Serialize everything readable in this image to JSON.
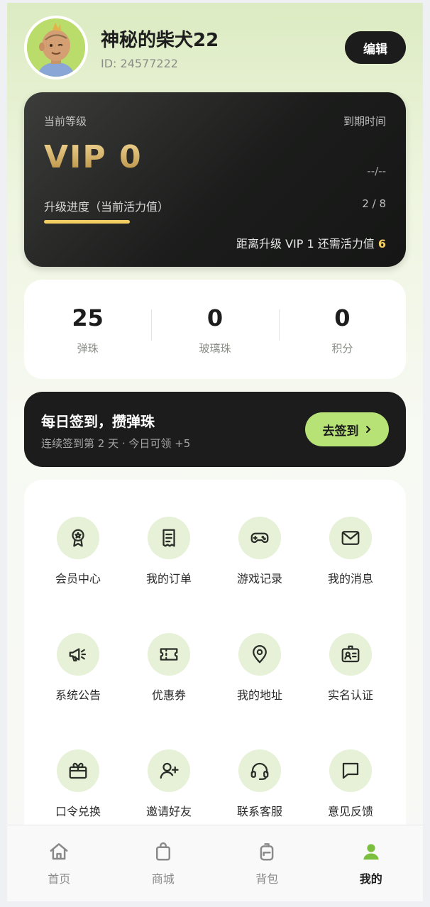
{
  "profile": {
    "username": "神秘的柴犬22",
    "id_text": "ID: 24577222",
    "edit_label": "编辑",
    "avatar_icon": "cartoon-avatar"
  },
  "vip": {
    "level_label": "当前等级",
    "level": "VIP 0",
    "expire_label": "到期时间",
    "expire_value": "--/--",
    "progress_label": "升级进度（当前活力值）",
    "progress_text": "2 / 8",
    "progress_fraction": 0.25,
    "upgrade_prefix": "距离升级 VIP 1 还需活力值 ",
    "upgrade_need": "6",
    "gold_color": "#f3cf63"
  },
  "stats": [
    {
      "value": "25",
      "label": "弹珠"
    },
    {
      "value": "0",
      "label": "玻璃珠"
    },
    {
      "value": "0",
      "label": "积分"
    }
  ],
  "checkin": {
    "title": "每日签到，攒弹珠",
    "subtitle": "连续签到第 2 天 · 今日可领 +5",
    "button_label": "去签到",
    "accent": "#b7e276"
  },
  "menu": [
    {
      "label": "会员中心",
      "icon": "medal-icon"
    },
    {
      "label": "我的订单",
      "icon": "receipt-icon"
    },
    {
      "label": "游戏记录",
      "icon": "gamepad-icon"
    },
    {
      "label": "我的消息",
      "icon": "mail-icon"
    },
    {
      "label": "系统公告",
      "icon": "megaphone-icon"
    },
    {
      "label": "优惠券",
      "icon": "ticket-icon"
    },
    {
      "label": "我的地址",
      "icon": "location-pin-icon"
    },
    {
      "label": "实名认证",
      "icon": "id-badge-icon"
    },
    {
      "label": "口令兑换",
      "icon": "gift-icon"
    },
    {
      "label": "邀请好友",
      "icon": "add-user-icon"
    },
    {
      "label": "联系客服",
      "icon": "headset-icon"
    },
    {
      "label": "意见反馈",
      "icon": "chat-icon"
    }
  ],
  "nav": [
    {
      "label": "首页",
      "icon": "home-icon",
      "active": false
    },
    {
      "label": "商城",
      "icon": "shopping-bag-icon",
      "active": false
    },
    {
      "label": "背包",
      "icon": "backpack-icon",
      "active": false
    },
    {
      "label": "我的",
      "icon": "user-icon",
      "active": true
    }
  ],
  "colors": {
    "nav_active": "#7cbf3f",
    "icon_bg": "#e6f1d7"
  }
}
